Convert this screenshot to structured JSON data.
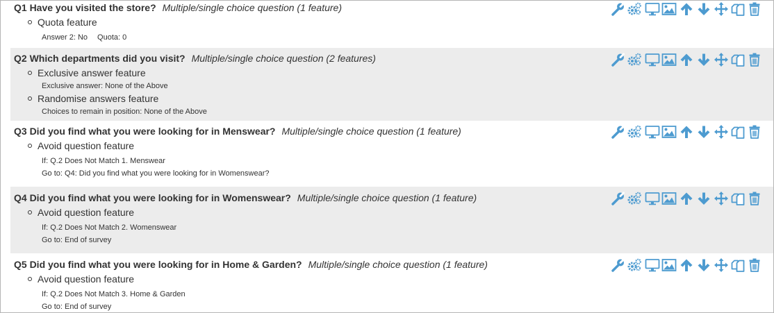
{
  "accent_color": "#4d9bd0",
  "icon_row": [
    "wrench-icon",
    "gears-icon",
    "monitor-icon",
    "image-icon",
    "arrow-up-icon",
    "arrow-down-icon",
    "move-icon",
    "copy-icon",
    "trash-icon"
  ],
  "questions": [
    {
      "title": "Q1 Have you visited the store?",
      "type": "Multiple/single choice question (1 feature)",
      "features": [
        {
          "label": "Quota feature",
          "details": [
            "Answer 2: No",
            "Quota: 0"
          ]
        }
      ]
    },
    {
      "title": "Q2 Which departments did you visit?",
      "type": "Multiple/single choice question (2 features)",
      "features": [
        {
          "label": "Exclusive answer feature",
          "details": [
            "Exclusive answer: None of the Above"
          ]
        },
        {
          "label": "Randomise answers feature",
          "details": [
            "Choices to remain in position: None of the Above"
          ]
        }
      ]
    },
    {
      "title": "Q3 Did you find what you were looking for in Menswear?",
      "type": "Multiple/single choice question (1 feature)",
      "features": [
        {
          "label": "Avoid question feature",
          "details": [
            "If: Q.2 Does Not Match 1. Menswear",
            "Go to: Q4: Did you find what you were looking for in Womenswear?"
          ]
        }
      ]
    },
    {
      "title": "Q4 Did you find what you were looking for in Womenswear?",
      "type": "Multiple/single choice question (1 feature)",
      "features": [
        {
          "label": "Avoid question feature",
          "details": [
            "If: Q.2 Does Not Match 2. Womenswear",
            "Go to: End of survey"
          ]
        }
      ]
    },
    {
      "title": "Q5 Did you find what you were looking for in Home & Garden?",
      "type": "Multiple/single choice question (1 feature)",
      "features": [
        {
          "label": "Avoid question feature",
          "details": [
            "If: Q.2 Does Not Match 3. Home & Garden",
            "Go to: End of survey"
          ]
        }
      ]
    }
  ]
}
